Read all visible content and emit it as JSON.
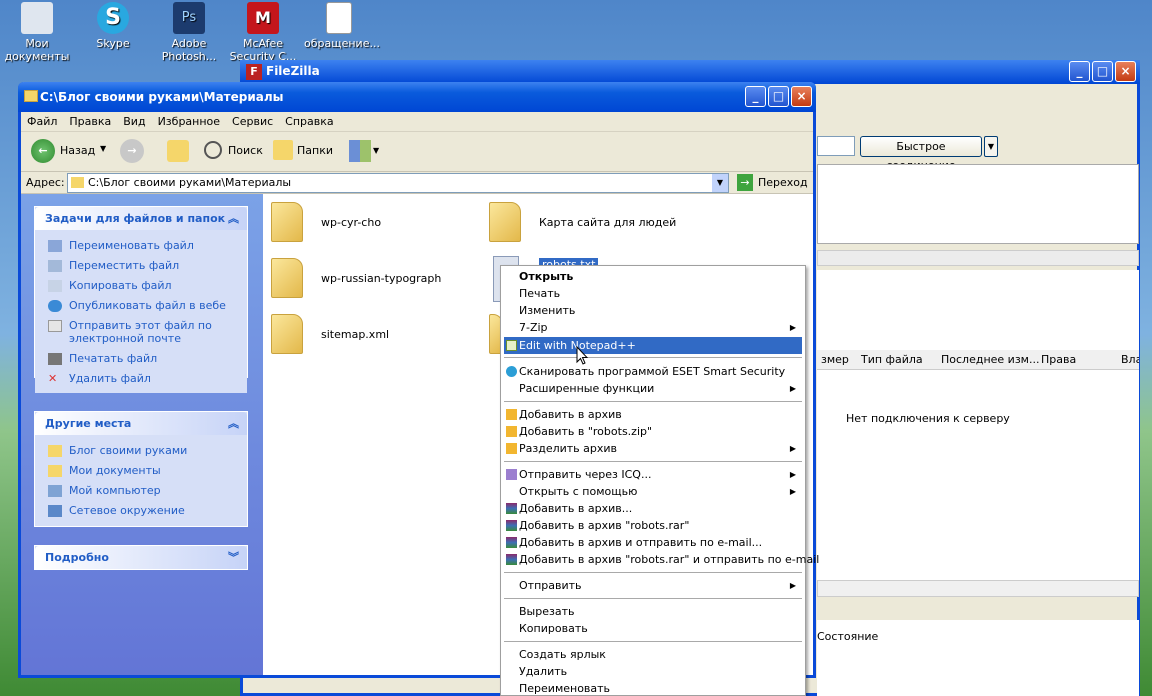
{
  "desktop": {
    "icons": [
      {
        "label": "Мои\nдокументы",
        "color": "#dfe6ef"
      },
      {
        "label": "Skype",
        "color": "#29a8e0"
      },
      {
        "label": "Adobe\nPhotosh...",
        "color": "#1c3b6e"
      },
      {
        "label": "McAfee\nSecurity C...",
        "color": "#c4161c"
      },
      {
        "label": "обращение...",
        "color": "#ffffff"
      }
    ]
  },
  "explorer": {
    "title": "C:\\Блог своими руками\\Материалы",
    "menu": [
      "Файл",
      "Правка",
      "Вид",
      "Избранное",
      "Сервис",
      "Справка"
    ],
    "toolbar": {
      "back": "Назад",
      "search": "Поиск",
      "folders": "Папки"
    },
    "address_label": "Адрес:",
    "address_value": "C:\\Блог своими руками\\Материалы",
    "go_label": "Переход",
    "tasks_title": "Задачи для файлов и папок",
    "tasks": [
      "Переименовать файл",
      "Переместить файл",
      "Копировать файл",
      "Опубликовать файл в вебе",
      "Отправить этот файл по\nэлектронной почте",
      "Печатать файл",
      "Удалить файл"
    ],
    "places_title": "Другие места",
    "places": [
      "Блог своими руками",
      "Мои документы",
      "Мой компьютер",
      "Сетевое окружение"
    ],
    "details_title": "Подробно",
    "files": [
      "wp-cyr-cho",
      "Карта сайта для людей",
      "wp-russian-typograph",
      "sitemap.xml"
    ],
    "selected_file": "robots.txt"
  },
  "filezilla": {
    "title": "FileZilla",
    "quickconnect_label": "Быстрое соединение",
    "columns": [
      "змер",
      "Тип файла",
      "Последнее изм...",
      "Права",
      "Вла"
    ],
    "no_connection": "Нет подключения к серверу",
    "queue_status": "Состояние"
  },
  "context_menu": {
    "open": "Открыть",
    "print": "Печать",
    "edit": "Изменить",
    "zip7": "7-Zip",
    "notepadpp": "Edit with Notepad++",
    "eset": "Сканировать программой ESET Smart Security",
    "advanced": "Расширенные функции",
    "add_archive_h": "Добавить в архив",
    "add_zip": "Добавить в \"robots.zip\"",
    "split": "Разделить архив",
    "icq": "Отправить через ICQ...",
    "open_with": "Открыть с помощью",
    "rar_add": "Добавить в архив...",
    "rar_add_named": "Добавить в архив \"robots.rar\"",
    "rar_add_email": "Добавить в архив и отправить по e-mail...",
    "rar_add_named_email": "Добавить в архив \"robots.rar\" и отправить по e-mail",
    "send_to": "Отправить",
    "cut": "Вырезать",
    "copy": "Копировать",
    "shortcut": "Создать ярлык",
    "delete": "Удалить",
    "rename": "Переименовать"
  }
}
